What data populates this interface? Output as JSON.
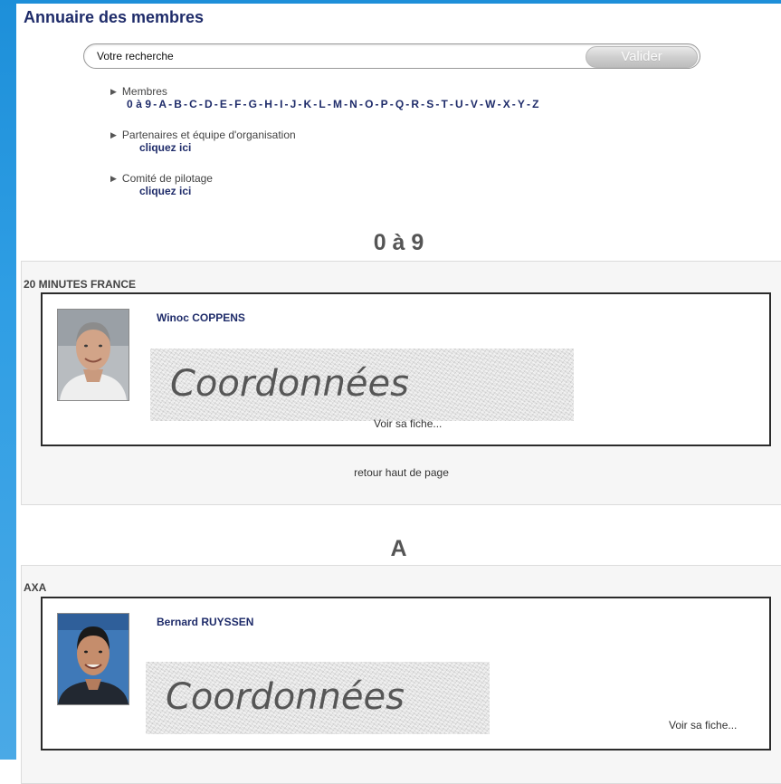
{
  "page_title": "Annuaire des membres",
  "search": {
    "placeholder": "Votre recherche",
    "button_label": "Valider"
  },
  "nav": {
    "members_label": "Membres",
    "alphabet": [
      "0 à 9",
      "A",
      "B",
      "C",
      "D",
      "E",
      "F",
      "G",
      "H",
      "I",
      "J",
      "K",
      "L",
      "M",
      "N",
      "O",
      "P",
      "Q",
      "R",
      "S",
      "T",
      "U",
      "V",
      "W",
      "X",
      "Y",
      "Z"
    ],
    "alphabet_separator": "-",
    "partners_label": "Partenaires et équipe d'organisation",
    "partners_link": "cliquez ici",
    "committee_label": "Comité de pilotage",
    "committee_link": "cliquez ici"
  },
  "sections": [
    {
      "heading": "0 à 9",
      "company": "20 MINUTES FRANCE",
      "member_name": "Winoc COPPENS",
      "coords_label": "Coordonnées",
      "view_link": "Voir sa fiche...",
      "back_to_top": "retour haut de page"
    },
    {
      "heading": "A",
      "company": "AXA",
      "member_name": "Bernard RUYSSEN",
      "coords_label": "Coordonnées",
      "view_link": "Voir sa fiche..."
    }
  ],
  "icons": {
    "bullet": "triangle-right-icon"
  },
  "colors": {
    "link_navy": "#1f2c6a",
    "edge_blue": "#1d8fd9",
    "panel_bg": "#f6f6f6"
  }
}
